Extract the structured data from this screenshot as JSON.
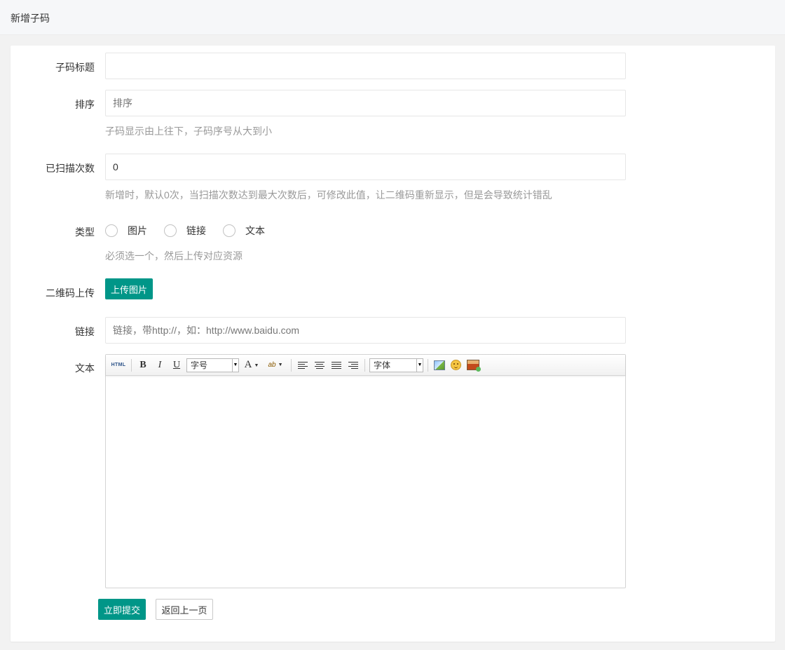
{
  "header": {
    "title": "新增子码"
  },
  "form": {
    "title_field": {
      "label": "子码标题",
      "value": "",
      "placeholder": ""
    },
    "sort_field": {
      "label": "排序",
      "value": "",
      "placeholder": "排序",
      "help": "子码显示由上往下，子码序号从大到小"
    },
    "scan_field": {
      "label": "已扫描次数",
      "value": "0",
      "help": "新增时，默认0次，当扫描次数达到最大次数后，可修改此值，让二维码重新显示，但是会导致统计错乱"
    },
    "type_field": {
      "label": "类型",
      "options": [
        "图片",
        "链接",
        "文本"
      ],
      "help": "必须选一个，然后上传对应资源"
    },
    "qrcode_field": {
      "label": "二维码上传",
      "button": "上传图片"
    },
    "link_field": {
      "label": "链接",
      "value": "",
      "placeholder": "链接，带http://，如：http://www.baidu.com"
    },
    "text_field": {
      "label": "文本",
      "toolbar": {
        "html_label": "HTML",
        "bold": "B",
        "italic": "I",
        "underline": "U",
        "font_size": "字号",
        "font_color": "A",
        "highlight": "ab",
        "font_family": "字体",
        "icons": [
          "html-icon",
          "bold-icon",
          "italic-icon",
          "underline-icon",
          "font-color-icon",
          "highlight-icon",
          "align-left-icon",
          "align-center-icon",
          "align-justify-icon",
          "align-right-icon",
          "image-icon",
          "emoticon-icon",
          "media-icon"
        ]
      }
    },
    "actions": {
      "submit": "立即提交",
      "back": "返回上一页"
    }
  },
  "colors": {
    "primary": "#009688",
    "page_bg": "#f2f2f2",
    "help_text": "#999999"
  }
}
